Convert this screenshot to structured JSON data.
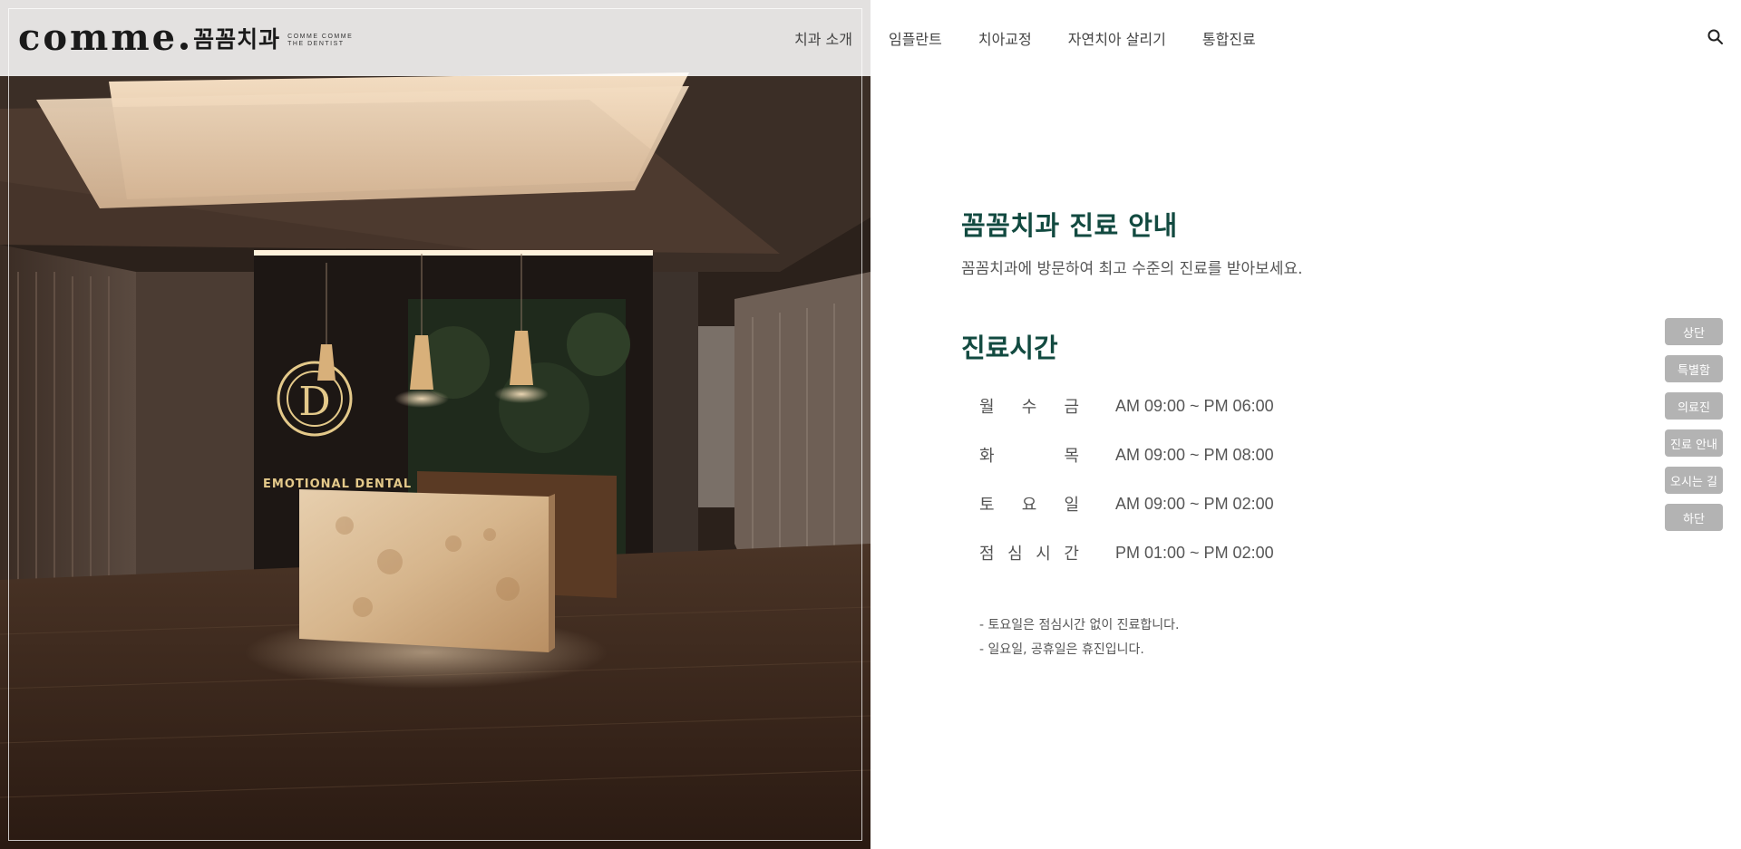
{
  "brand": {
    "logo_word": "comme",
    "logo_korean": "꼼꼼치과",
    "logo_sub_line1": "COMME COMME",
    "logo_sub_line2": "THE DENTIST"
  },
  "nav": {
    "items": [
      {
        "label": "치과 소개"
      },
      {
        "label": "임플란트"
      },
      {
        "label": "치아교정"
      },
      {
        "label": "자연치아 살리기"
      },
      {
        "label": "통합진료"
      }
    ],
    "search_icon": "search-icon"
  },
  "photo": {
    "sign_text": "EMOTIONAL DENTAL CARE",
    "emblem_letter": "D"
  },
  "main": {
    "title": "꼼꼼치과 진료 안내",
    "subtitle": "꼼꼼치과에 방문하여 최고 수준의 진료를 받아보세요.",
    "hours_title": "진료시간",
    "hours": [
      {
        "day_chars": [
          "월",
          "수",
          "금"
        ],
        "time": "AM 09:00 ~ PM 06:00"
      },
      {
        "day_chars": [
          "화",
          "목"
        ],
        "time": "AM 09:00 ~ PM 08:00"
      },
      {
        "day_chars": [
          "토",
          "요",
          "일"
        ],
        "time": "AM 09:00 ~ PM 02:00"
      },
      {
        "day_chars": [
          "점",
          "심",
          "시",
          "간"
        ],
        "time": "PM 01:00 ~ PM 02:00"
      }
    ],
    "notes": [
      "- 토요일은 점심시간 없이 진료합니다.",
      "- 일요일, 공휴일은 휴진입니다."
    ]
  },
  "quick_nav": {
    "items": [
      {
        "label": "상단"
      },
      {
        "label": "특별함"
      },
      {
        "label": "의료진"
      },
      {
        "label": "진료 안내"
      },
      {
        "label": "오시는 길"
      },
      {
        "label": "하단"
      }
    ]
  },
  "colors": {
    "heading": "#124a40",
    "quick_button": "#b3b3b3",
    "text": "#555555"
  }
}
